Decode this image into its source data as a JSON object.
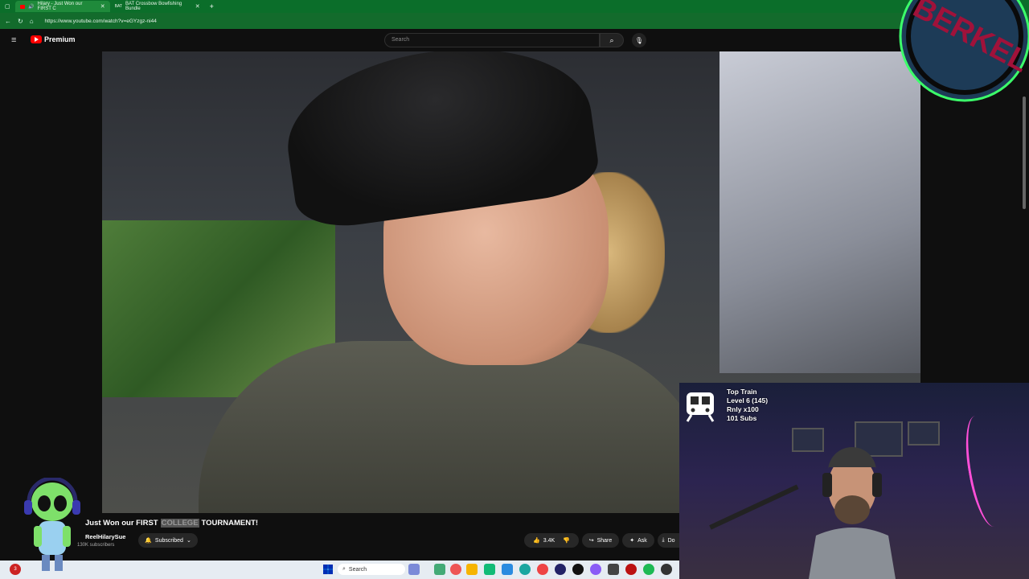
{
  "browser": {
    "tabs": [
      {
        "label": "Hilary - Just Won our FIRST C",
        "active": true
      },
      {
        "label": "BAT Crossbow Bowfishing Bundle",
        "active": false
      }
    ],
    "url": "https://www.youtube.com/watch?v=eGYzgz-ni44",
    "accent_color": "#0b6e2a"
  },
  "youtube": {
    "logo_text": "Premium",
    "search_placeholder": "Search",
    "video_title_parts": [
      "Just Won our FIRST",
      "COLLEGE",
      "TOURNAMENT!"
    ],
    "channel_name": "ReelHilarySue",
    "subscriber_count": "130K subscribers",
    "subscribed_label": "Subscribed",
    "like_count": "3.4K",
    "share_label": "Share",
    "ask_label": "Ask",
    "download_label": "Do"
  },
  "stream_overlay": {
    "train_title": "Top Train",
    "train_level": "Level 6  (145)",
    "train_multiplier": "Rnly x100",
    "train_subs": "101 Subs",
    "logo_text": "BERKEL"
  },
  "taskbar": {
    "search_label": "Search",
    "notification_count": "3"
  }
}
